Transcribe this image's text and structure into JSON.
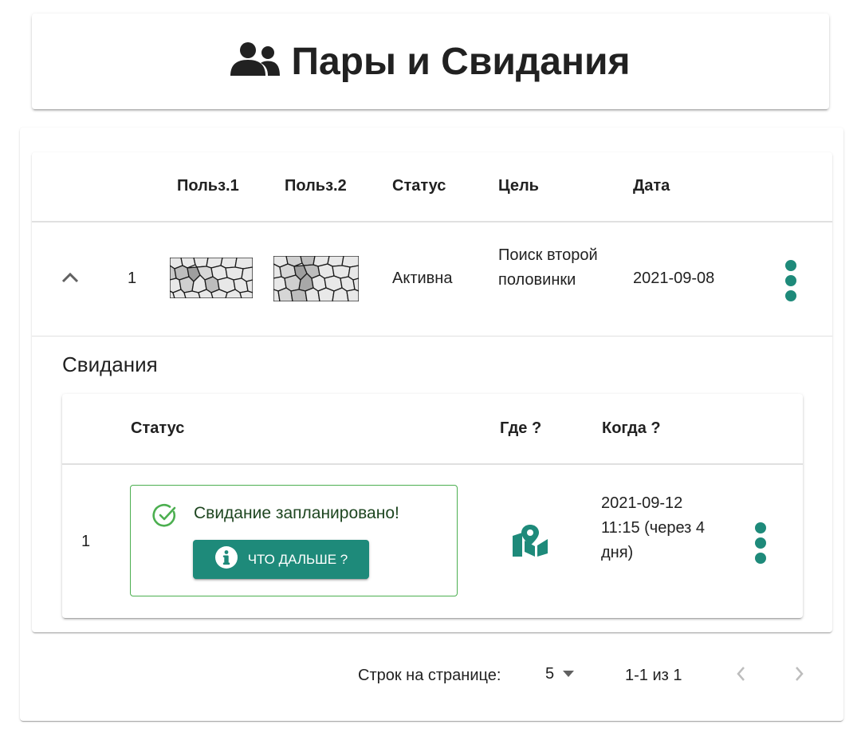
{
  "header": {
    "title": "Пары и Свидания",
    "icon": "users-icon"
  },
  "pairs_table": {
    "columns": [
      "",
      "",
      "Польз.1",
      "Польз.2",
      "Статус",
      "Цель",
      "Дата",
      ""
    ],
    "rows": [
      {
        "index": "1",
        "user1_avatar": "user1-avatar",
        "user2_avatar": "user2-avatar",
        "status": "Активна",
        "goal": "Поиск второй половинки",
        "date": "2021-09-08",
        "expanded": true
      }
    ]
  },
  "dates_section": {
    "title": "Свидания",
    "columns": [
      "",
      "Статус",
      "Где ?",
      "Когда ?",
      ""
    ],
    "rows": [
      {
        "index": "1",
        "status_message": "Свидание запланировано!",
        "next_button": "ЧТО ДАЛЬШЕ ?",
        "where_icon": "map-marker-icon",
        "when": "2021-09-12 11:15 (через 4 дня)"
      }
    ]
  },
  "pagination": {
    "rows_per_page_label": "Строк на странице:",
    "rows_per_page_value": "5",
    "range": "1-1 из 1"
  },
  "colors": {
    "accent": "#1e8a7a",
    "success": "#4caf50"
  }
}
